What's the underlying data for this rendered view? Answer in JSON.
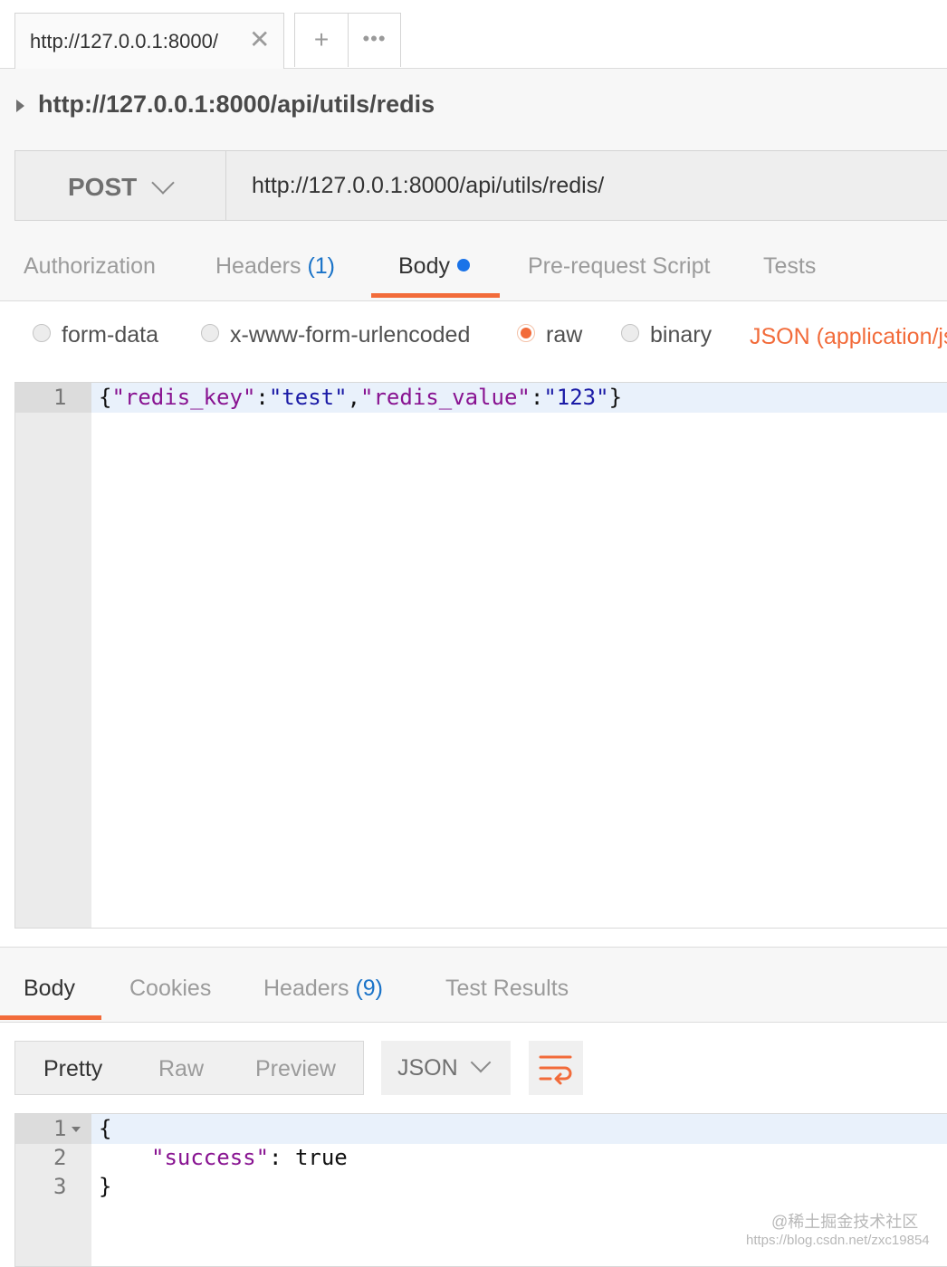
{
  "top_tabs": {
    "request_tab_label": "http://127.0.0.1:8000/",
    "close_glyph": "✕",
    "add_glyph": "+",
    "more_glyph": "•••"
  },
  "request": {
    "title": "http://127.0.0.1:8000/api/utils/redis",
    "method": "POST",
    "url": "http://127.0.0.1:8000/api/utils/redis/"
  },
  "request_tabs": [
    {
      "label": "Authorization",
      "count": ""
    },
    {
      "label": "Headers",
      "count": "(1)"
    },
    {
      "label": "Body",
      "count": "",
      "active": true
    },
    {
      "label": "Pre-request Script",
      "count": ""
    },
    {
      "label": "Tests",
      "count": ""
    }
  ],
  "body_types": [
    {
      "label": "form-data",
      "selected": false
    },
    {
      "label": "x-www-form-urlencoded",
      "selected": false
    },
    {
      "label": "raw",
      "selected": true
    },
    {
      "label": "binary",
      "selected": false
    }
  ],
  "content_type": "JSON (application/js",
  "request_editor": {
    "line_numbers": [
      "1"
    ],
    "line1_parts": [
      "{",
      "\"redis_key\"",
      ":",
      "\"test\"",
      ",",
      "\"redis_value\"",
      ":",
      "\"123\"",
      "}"
    ]
  },
  "response_tabs": [
    {
      "label": "Body",
      "count": "",
      "active": true
    },
    {
      "label": "Cookies",
      "count": ""
    },
    {
      "label": "Headers",
      "count": "(9)"
    },
    {
      "label": "Test Results",
      "count": ""
    }
  ],
  "view_modes": [
    "Pretty",
    "Raw",
    "Preview"
  ],
  "format": "JSON",
  "icons": {
    "wrap": "wrap-lines-icon",
    "close": "close-icon",
    "add": "plus-icon",
    "more": "more-icon"
  },
  "response_editor": {
    "line_numbers": [
      "1",
      "2",
      "3"
    ],
    "line1": "{",
    "line2_key": "\"success\"",
    "line2_sep": ": ",
    "line2_value": "true",
    "line3": "}"
  },
  "watermark": {
    "line1": "@稀土掘金技术社区",
    "line2": "https://blog.csdn.net/zxc19854"
  },
  "colors": {
    "accent": "#f26b3a",
    "blue": "#1a73e8",
    "json_key": "#881391",
    "json_string": "#1a1aa6"
  }
}
